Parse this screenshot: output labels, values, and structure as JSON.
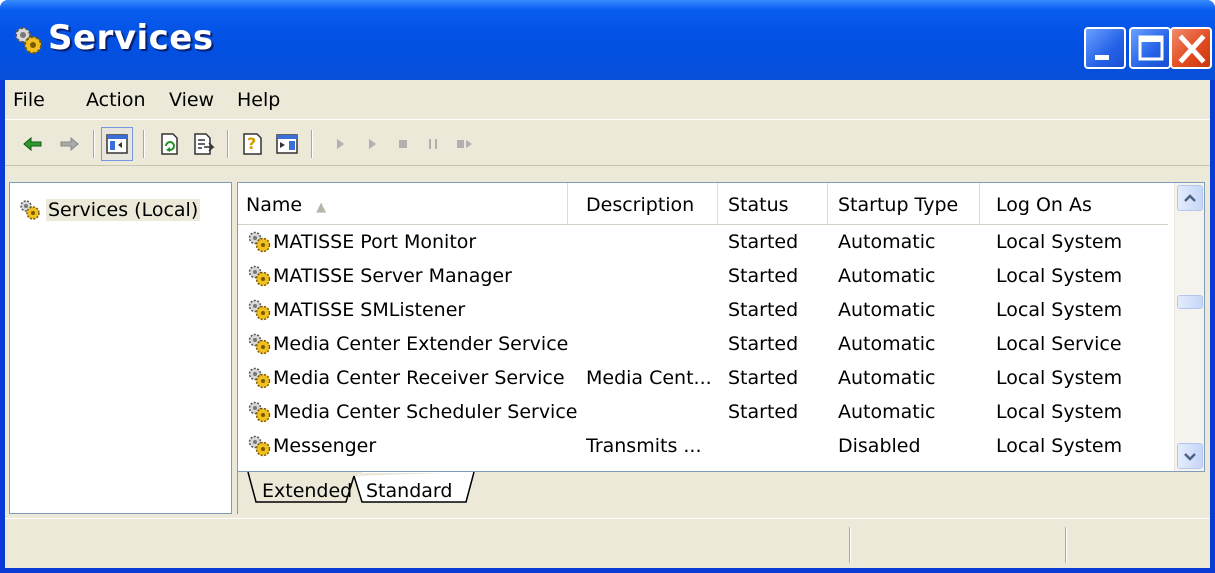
{
  "window": {
    "title": "Services",
    "controls": [
      "minimize-icon",
      "maximize-icon",
      "close-icon"
    ],
    "frame_color": "#0a3bd6",
    "title_color": "#0453e6"
  },
  "menubar": {
    "items": [
      {
        "label": "File"
      },
      {
        "label": "Action"
      },
      {
        "label": "View"
      },
      {
        "label": "Help"
      }
    ]
  },
  "toolbar": {
    "buttons": [
      "back-arrow-icon",
      "forward-arrow-icon",
      "show-hide-console-tree-icon",
      "refresh-icon",
      "export-list-icon",
      "help-icon",
      "properties-icon",
      "start-service-icon",
      "start-service-alt-icon",
      "stop-service-icon",
      "pause-service-icon",
      "restart-service-icon"
    ]
  },
  "tree": {
    "root_label": "Services (Local)",
    "root_icon": "gears-icon"
  },
  "table": {
    "columns": [
      "Name",
      "Description",
      "Status",
      "Startup Type",
      "Log On As"
    ],
    "sorted_column": "Name",
    "rows": [
      {
        "name": "MATISSE Port Monitor",
        "description": "",
        "status": "Started",
        "startup": "Automatic",
        "logon": "Local System"
      },
      {
        "name": "MATISSE Server Manager",
        "description": "",
        "status": "Started",
        "startup": "Automatic",
        "logon": "Local System"
      },
      {
        "name": "MATISSE SMListener",
        "description": "",
        "status": "Started",
        "startup": "Automatic",
        "logon": "Local System"
      },
      {
        "name": "Media Center Extender Service",
        "description": "",
        "status": "Started",
        "startup": "Automatic",
        "logon": "Local Service"
      },
      {
        "name": "Media Center Receiver Service",
        "description": "Media Cent...",
        "status": "Started",
        "startup": "Automatic",
        "logon": "Local System"
      },
      {
        "name": "Media Center Scheduler Service",
        "description": "",
        "status": "Started",
        "startup": "Automatic",
        "logon": "Local System"
      },
      {
        "name": "Messenger",
        "description": "Transmits ...",
        "status": "",
        "startup": "Disabled",
        "logon": "Local System"
      }
    ]
  },
  "tabs": [
    {
      "label": "Extended",
      "active": false
    },
    {
      "label": "Standard",
      "active": true
    }
  ]
}
